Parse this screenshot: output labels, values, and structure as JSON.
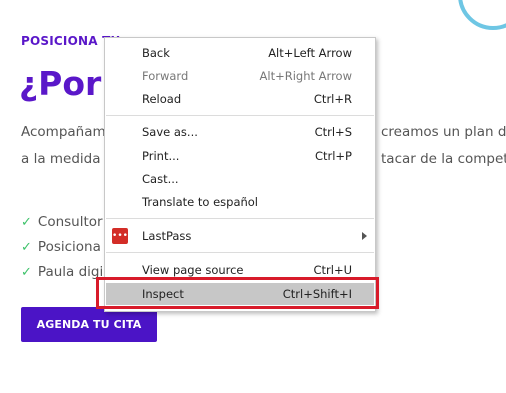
{
  "page": {
    "kicker": "POSICIONA TU",
    "headline": "¿Por q",
    "paragraph_line1_left": "Acompañam",
    "paragraph_line1_right": "creamos un plan de m",
    "paragraph_line2_left": "a la medida y",
    "paragraph_line2_right": "tacar de la compete",
    "checklist": [
      "Consultor",
      "Posiciona",
      "Paula digi"
    ],
    "cta_label": "AGENDA TU CITA",
    "check_glyph": "✓"
  },
  "context_menu": {
    "groups": [
      [
        {
          "label": "Back",
          "shortcut": "Alt+Left Arrow",
          "disabled": false
        },
        {
          "label": "Forward",
          "shortcut": "Alt+Right Arrow",
          "disabled": true
        },
        {
          "label": "Reload",
          "shortcut": "Ctrl+R",
          "disabled": false
        }
      ],
      [
        {
          "label": "Save as...",
          "shortcut": "Ctrl+S",
          "disabled": false
        },
        {
          "label": "Print...",
          "shortcut": "Ctrl+P",
          "disabled": false
        },
        {
          "label": "Cast...",
          "shortcut": "",
          "disabled": false
        },
        {
          "label": "Translate to español",
          "shortcut": "",
          "disabled": false
        }
      ],
      [
        {
          "label": "LastPass",
          "shortcut": "",
          "icon": "lastpass-icon",
          "submenu": true
        }
      ],
      [
        {
          "label": "View page source",
          "shortcut": "Ctrl+U",
          "disabled": false
        },
        {
          "label": "Inspect",
          "shortcut": "Ctrl+Shift+I",
          "highlighted": true
        }
      ]
    ],
    "lastpass_glyph": "•••"
  },
  "colors": {
    "brand_purple": "#5a17c9",
    "cta_bg": "#4b14c6",
    "check_green": "#3ec26a",
    "highlight_red": "#d81b2a",
    "hover_gray": "#c7c7c7"
  }
}
